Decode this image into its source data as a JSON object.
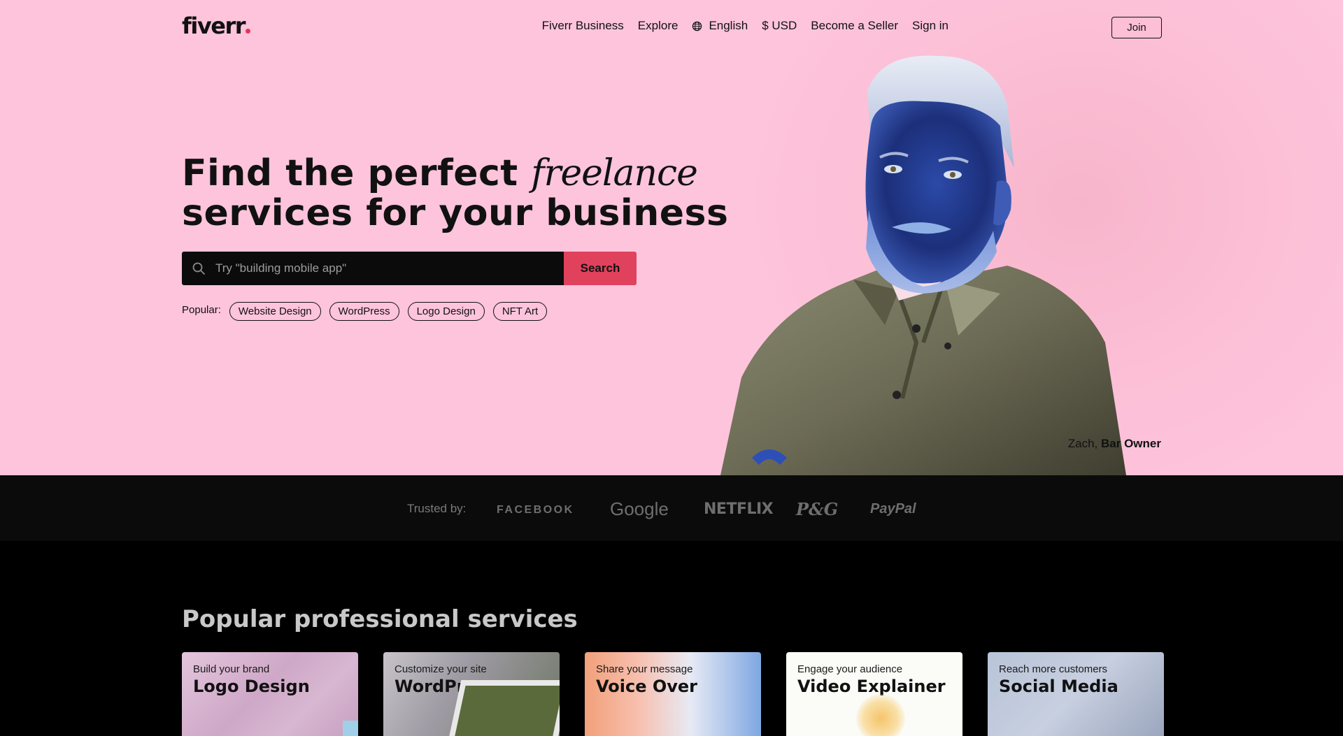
{
  "nav": {
    "logo": "fiverr",
    "links": [
      "Fiverr Business",
      "Explore",
      "English",
      "$ USD",
      "Become a Seller",
      "Sign in"
    ],
    "join_label": "Join"
  },
  "hero": {
    "headline_part1": "Find the perfect ",
    "headline_italic": "freelance",
    "headline_part2": "services for your business",
    "search_placeholder": "Try \"building mobile app\"",
    "search_button": "Search",
    "popular_label": "Popular:",
    "popular_tags": [
      "Website Design",
      "WordPress",
      "Logo Design",
      "NFT Art"
    ],
    "caption_name": "Zach,",
    "caption_role": "Bar Owner"
  },
  "trusted": {
    "label": "Trusted by:",
    "brands": [
      "FACEBOOK",
      "Google",
      "NETFLIX",
      "P&G",
      "PayPal"
    ]
  },
  "services": {
    "title": "Popular professional services",
    "cards": [
      {
        "subtitle": "Build your brand",
        "title": "Logo Design"
      },
      {
        "subtitle": "Customize your site",
        "title": "WordPress"
      },
      {
        "subtitle": "Share your message",
        "title": "Voice Over"
      },
      {
        "subtitle": "Engage your audience",
        "title": "Video Explainer"
      },
      {
        "subtitle": "Reach more customers",
        "title": "Social Media"
      }
    ]
  },
  "colors": {
    "hero_bg": "#fdc4dc",
    "accent": "#e0415c",
    "dark_bg": "#000000"
  }
}
